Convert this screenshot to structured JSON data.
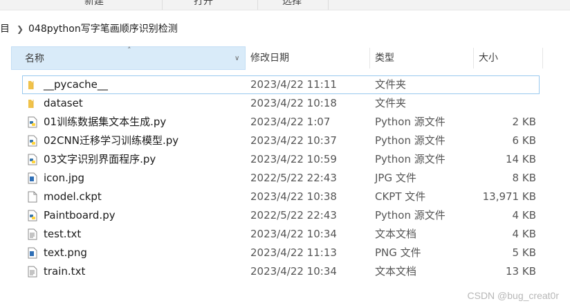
{
  "ribbon": {
    "groups": [
      "新建",
      "打开",
      "选择"
    ]
  },
  "address": {
    "root_label": "目",
    "folder": "048python写字笔画顺序识别检测"
  },
  "columns": {
    "name": "名称",
    "date": "修改日期",
    "type": "类型",
    "size": "大小"
  },
  "files": [
    {
      "name": "__pycache__",
      "date": "2023/4/22 11:11",
      "type": "文件夹",
      "size": "",
      "icon": "folder-icon"
    },
    {
      "name": "dataset",
      "date": "2023/4/22 10:18",
      "type": "文件夹",
      "size": "",
      "icon": "folder-icon"
    },
    {
      "name": "01训练数据集文本生成.py",
      "date": "2023/4/22 1:07",
      "type": "Python 源文件",
      "size": "2 KB",
      "icon": "python-file-icon"
    },
    {
      "name": "02CNN迁移学习训练模型.py",
      "date": "2023/4/22 10:37",
      "type": "Python 源文件",
      "size": "6 KB",
      "icon": "python-file-icon"
    },
    {
      "name": "03文字识别界面程序.py",
      "date": "2023/4/22 10:59",
      "type": "Python 源文件",
      "size": "14 KB",
      "icon": "python-file-icon"
    },
    {
      "name": "icon.jpg",
      "date": "2022/5/22 22:43",
      "type": "JPG 文件",
      "size": "8 KB",
      "icon": "image-file-icon"
    },
    {
      "name": "model.ckpt",
      "date": "2023/4/22 10:38",
      "type": "CKPT 文件",
      "size": "13,971 KB",
      "icon": "generic-file-icon"
    },
    {
      "name": "Paintboard.py",
      "date": "2022/5/22 22:43",
      "type": "Python 源文件",
      "size": "4 KB",
      "icon": "python-file-icon"
    },
    {
      "name": "test.txt",
      "date": "2023/4/22 10:34",
      "type": "文本文档",
      "size": "4 KB",
      "icon": "text-file-icon"
    },
    {
      "name": "text.png",
      "date": "2023/4/22 11:13",
      "type": "PNG 文件",
      "size": "5 KB",
      "icon": "image-file-icon"
    },
    {
      "name": "train.txt",
      "date": "2023/4/22 10:34",
      "type": "文本文档",
      "size": "13 KB",
      "icon": "text-file-icon"
    }
  ],
  "watermark": "CSDN @bug_creat0r",
  "colors": {
    "folder": "#f0c24a",
    "python_blue": "#3776ab",
    "python_yellow": "#ffd43b",
    "header_selected": "#d9ebf9",
    "focus_border": "#99c9ef"
  }
}
